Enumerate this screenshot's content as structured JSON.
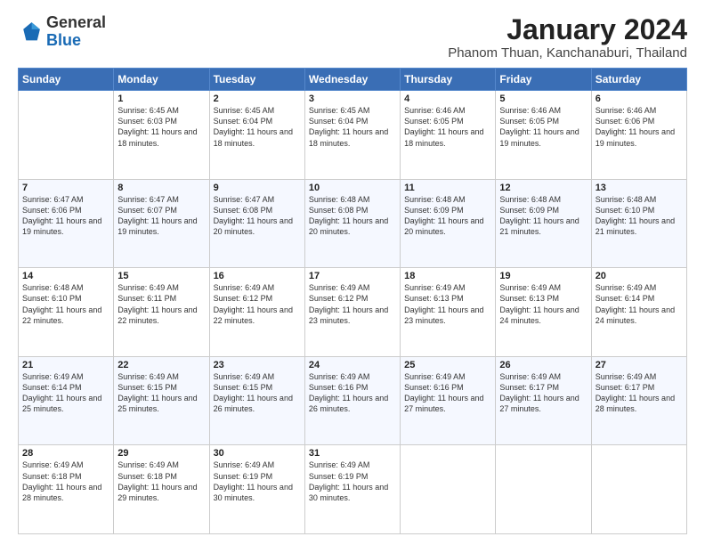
{
  "logo": {
    "general": "General",
    "blue": "Blue"
  },
  "header": {
    "title": "January 2024",
    "subtitle": "Phanom Thuan, Kanchanaburi, Thailand"
  },
  "weekdays": [
    "Sunday",
    "Monday",
    "Tuesday",
    "Wednesday",
    "Thursday",
    "Friday",
    "Saturday"
  ],
  "weeks": [
    [
      {
        "day": "",
        "sunrise": "",
        "sunset": "",
        "daylight": ""
      },
      {
        "day": "1",
        "sunrise": "Sunrise: 6:45 AM",
        "sunset": "Sunset: 6:03 PM",
        "daylight": "Daylight: 11 hours and 18 minutes."
      },
      {
        "day": "2",
        "sunrise": "Sunrise: 6:45 AM",
        "sunset": "Sunset: 6:04 PM",
        "daylight": "Daylight: 11 hours and 18 minutes."
      },
      {
        "day": "3",
        "sunrise": "Sunrise: 6:45 AM",
        "sunset": "Sunset: 6:04 PM",
        "daylight": "Daylight: 11 hours and 18 minutes."
      },
      {
        "day": "4",
        "sunrise": "Sunrise: 6:46 AM",
        "sunset": "Sunset: 6:05 PM",
        "daylight": "Daylight: 11 hours and 18 minutes."
      },
      {
        "day": "5",
        "sunrise": "Sunrise: 6:46 AM",
        "sunset": "Sunset: 6:05 PM",
        "daylight": "Daylight: 11 hours and 19 minutes."
      },
      {
        "day": "6",
        "sunrise": "Sunrise: 6:46 AM",
        "sunset": "Sunset: 6:06 PM",
        "daylight": "Daylight: 11 hours and 19 minutes."
      }
    ],
    [
      {
        "day": "7",
        "sunrise": "Sunrise: 6:47 AM",
        "sunset": "Sunset: 6:06 PM",
        "daylight": "Daylight: 11 hours and 19 minutes."
      },
      {
        "day": "8",
        "sunrise": "Sunrise: 6:47 AM",
        "sunset": "Sunset: 6:07 PM",
        "daylight": "Daylight: 11 hours and 19 minutes."
      },
      {
        "day": "9",
        "sunrise": "Sunrise: 6:47 AM",
        "sunset": "Sunset: 6:08 PM",
        "daylight": "Daylight: 11 hours and 20 minutes."
      },
      {
        "day": "10",
        "sunrise": "Sunrise: 6:48 AM",
        "sunset": "Sunset: 6:08 PM",
        "daylight": "Daylight: 11 hours and 20 minutes."
      },
      {
        "day": "11",
        "sunrise": "Sunrise: 6:48 AM",
        "sunset": "Sunset: 6:09 PM",
        "daylight": "Daylight: 11 hours and 20 minutes."
      },
      {
        "day": "12",
        "sunrise": "Sunrise: 6:48 AM",
        "sunset": "Sunset: 6:09 PM",
        "daylight": "Daylight: 11 hours and 21 minutes."
      },
      {
        "day": "13",
        "sunrise": "Sunrise: 6:48 AM",
        "sunset": "Sunset: 6:10 PM",
        "daylight": "Daylight: 11 hours and 21 minutes."
      }
    ],
    [
      {
        "day": "14",
        "sunrise": "Sunrise: 6:48 AM",
        "sunset": "Sunset: 6:10 PM",
        "daylight": "Daylight: 11 hours and 22 minutes."
      },
      {
        "day": "15",
        "sunrise": "Sunrise: 6:49 AM",
        "sunset": "Sunset: 6:11 PM",
        "daylight": "Daylight: 11 hours and 22 minutes."
      },
      {
        "day": "16",
        "sunrise": "Sunrise: 6:49 AM",
        "sunset": "Sunset: 6:12 PM",
        "daylight": "Daylight: 11 hours and 22 minutes."
      },
      {
        "day": "17",
        "sunrise": "Sunrise: 6:49 AM",
        "sunset": "Sunset: 6:12 PM",
        "daylight": "Daylight: 11 hours and 23 minutes."
      },
      {
        "day": "18",
        "sunrise": "Sunrise: 6:49 AM",
        "sunset": "Sunset: 6:13 PM",
        "daylight": "Daylight: 11 hours and 23 minutes."
      },
      {
        "day": "19",
        "sunrise": "Sunrise: 6:49 AM",
        "sunset": "Sunset: 6:13 PM",
        "daylight": "Daylight: 11 hours and 24 minutes."
      },
      {
        "day": "20",
        "sunrise": "Sunrise: 6:49 AM",
        "sunset": "Sunset: 6:14 PM",
        "daylight": "Daylight: 11 hours and 24 minutes."
      }
    ],
    [
      {
        "day": "21",
        "sunrise": "Sunrise: 6:49 AM",
        "sunset": "Sunset: 6:14 PM",
        "daylight": "Daylight: 11 hours and 25 minutes."
      },
      {
        "day": "22",
        "sunrise": "Sunrise: 6:49 AM",
        "sunset": "Sunset: 6:15 PM",
        "daylight": "Daylight: 11 hours and 25 minutes."
      },
      {
        "day": "23",
        "sunrise": "Sunrise: 6:49 AM",
        "sunset": "Sunset: 6:15 PM",
        "daylight": "Daylight: 11 hours and 26 minutes."
      },
      {
        "day": "24",
        "sunrise": "Sunrise: 6:49 AM",
        "sunset": "Sunset: 6:16 PM",
        "daylight": "Daylight: 11 hours and 26 minutes."
      },
      {
        "day": "25",
        "sunrise": "Sunrise: 6:49 AM",
        "sunset": "Sunset: 6:16 PM",
        "daylight": "Daylight: 11 hours and 27 minutes."
      },
      {
        "day": "26",
        "sunrise": "Sunrise: 6:49 AM",
        "sunset": "Sunset: 6:17 PM",
        "daylight": "Daylight: 11 hours and 27 minutes."
      },
      {
        "day": "27",
        "sunrise": "Sunrise: 6:49 AM",
        "sunset": "Sunset: 6:17 PM",
        "daylight": "Daylight: 11 hours and 28 minutes."
      }
    ],
    [
      {
        "day": "28",
        "sunrise": "Sunrise: 6:49 AM",
        "sunset": "Sunset: 6:18 PM",
        "daylight": "Daylight: 11 hours and 28 minutes."
      },
      {
        "day": "29",
        "sunrise": "Sunrise: 6:49 AM",
        "sunset": "Sunset: 6:18 PM",
        "daylight": "Daylight: 11 hours and 29 minutes."
      },
      {
        "day": "30",
        "sunrise": "Sunrise: 6:49 AM",
        "sunset": "Sunset: 6:19 PM",
        "daylight": "Daylight: 11 hours and 30 minutes."
      },
      {
        "day": "31",
        "sunrise": "Sunrise: 6:49 AM",
        "sunset": "Sunset: 6:19 PM",
        "daylight": "Daylight: 11 hours and 30 minutes."
      },
      {
        "day": "",
        "sunrise": "",
        "sunset": "",
        "daylight": ""
      },
      {
        "day": "",
        "sunrise": "",
        "sunset": "",
        "daylight": ""
      },
      {
        "day": "",
        "sunrise": "",
        "sunset": "",
        "daylight": ""
      }
    ]
  ]
}
